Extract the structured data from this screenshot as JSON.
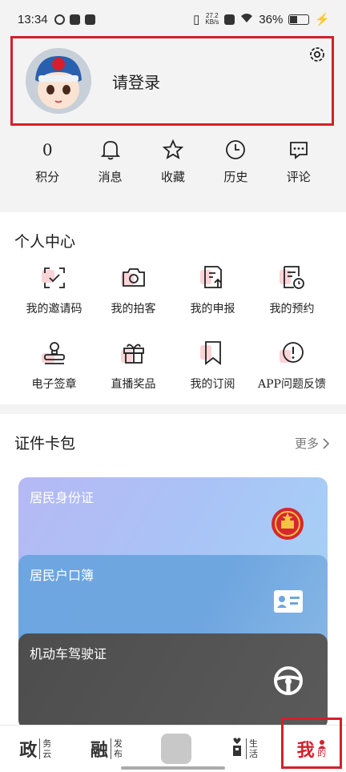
{
  "status_bar": {
    "time": "13:34",
    "net_speed_value": "27.2",
    "net_speed_unit": "KB/s",
    "battery": "36%"
  },
  "profile": {
    "login_prompt": "请登录"
  },
  "quick_actions": [
    {
      "value": "0",
      "label": "积分"
    },
    {
      "label": "消息",
      "icon": "bell-icon"
    },
    {
      "label": "收藏",
      "icon": "star-icon"
    },
    {
      "label": "历史",
      "icon": "clock-icon"
    },
    {
      "label": "评论",
      "icon": "comment-icon"
    }
  ],
  "personal_center": {
    "title": "个人中心",
    "items": [
      {
        "label": "我的邀请码",
        "icon": "scan-code-icon"
      },
      {
        "label": "我的拍客",
        "icon": "camera-icon"
      },
      {
        "label": "我的申报",
        "icon": "document-upload-icon"
      },
      {
        "label": "我的预约",
        "icon": "document-clock-icon"
      },
      {
        "label": "电子签章",
        "icon": "stamp-icon"
      },
      {
        "label": "直播奖品",
        "icon": "gift-icon"
      },
      {
        "label": "我的订阅",
        "icon": "bookmark-icon"
      },
      {
        "label": "APP问题反馈",
        "icon": "alert-circle-icon"
      }
    ]
  },
  "wallet": {
    "title": "证件卡包",
    "more_label": "更多",
    "cards": [
      {
        "title": "居民身份证",
        "icon": "national-emblem-icon"
      },
      {
        "title": "居民户口簿",
        "icon": "id-card-icon"
      },
      {
        "title": "机动车驾驶证",
        "icon": "steering-wheel-icon"
      }
    ]
  },
  "bottom_nav": [
    {
      "big": "政",
      "small": "务\n云"
    },
    {
      "big": "融",
      "small": "发\n布"
    },
    {
      "big": "",
      "small": ""
    },
    {
      "big": "",
      "small": "生\n活"
    },
    {
      "big": "我",
      "small": "的"
    }
  ],
  "colors": {
    "accent": "#d3202a"
  }
}
